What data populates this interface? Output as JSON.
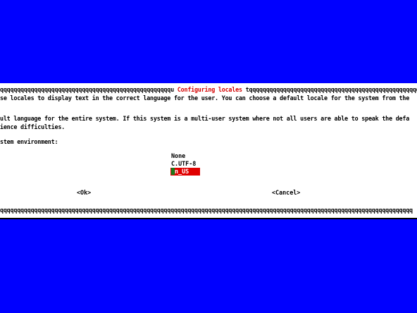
{
  "colors": {
    "background": "#0000ff",
    "dialog": "#ffffff",
    "title": "#d40000",
    "selection": "#e00000",
    "cursor": "#1a7a1a"
  },
  "dialog": {
    "title_left": "qqqqqqqqqqqqqqqqqqqqqqqqqqqqqqqqqqqqqqqqqqqqqqqqqqu ",
    "title": "Configuring locales",
    "title_right": " tqqqqqqqqqqqqqqqqqqqqqqqqqqqqqqqqqqqqqqqqqqqqqqqqqqqqqqqqqqqqqqqqq",
    "text_lines": [
      "se locales to display text in the correct language for the user. You can choose a default locale for the system from the",
      "",
      "ult language for the entire system. If this system is a multi-user system where not all users are able to speak the defa",
      "ience difficulties.",
      "",
      "stem environment:"
    ],
    "locale_options": [
      "None",
      "C.UTF-8",
      "n_US"
    ],
    "selected_index": 2,
    "ok_label": "<Ok>",
    "cancel_label": "<Cancel>",
    "bottom_border": "qqqqqqqqqqqqqqqqqqqqqqqqqqqqqqqqqqqqqqqqqqqqqqqqqqqqqqqqqqqqqqqqqqqqqqqqqqqqqqqqqqqqqqqqqqqqqqqqqqqqqqqqqqqqqqqqqqqqqqqqq"
  }
}
